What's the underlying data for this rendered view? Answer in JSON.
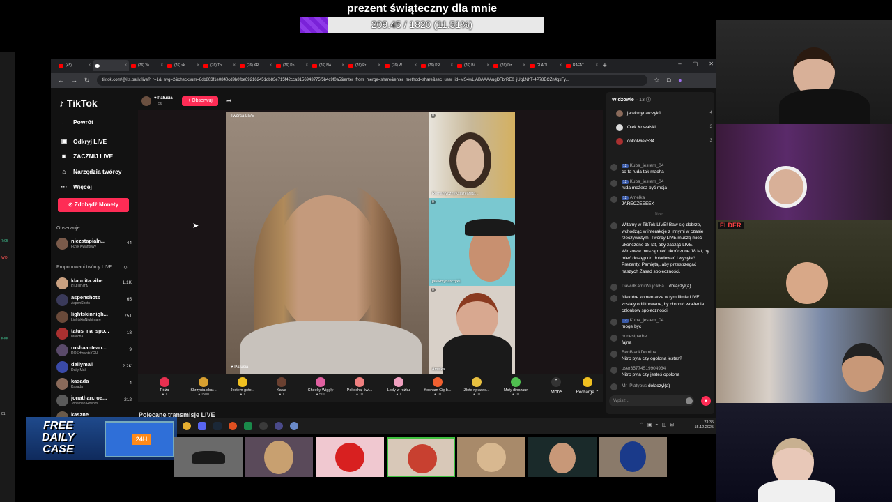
{
  "goal": {
    "title": "prezent świąteczny dla mnie",
    "progress_text": "209.45 / 1820 (11.51%)",
    "progress_fraction": 0.1151
  },
  "browser": {
    "tabs": [
      {
        "label": "(45)",
        "active": false
      },
      {
        "label": "",
        "active": true
      },
      {
        "label": "(76) Yo",
        "active": false
      },
      {
        "label": "(76) sk",
        "active": false
      },
      {
        "label": "(76) Th",
        "active": false
      },
      {
        "label": "(76) KR",
        "active": false
      },
      {
        "label": "(76) Po",
        "active": false
      },
      {
        "label": "(76) NA",
        "active": false
      },
      {
        "label": "(76) Pr",
        "active": false
      },
      {
        "label": "(76) W",
        "active": false
      },
      {
        "label": "(76) PR",
        "active": false
      },
      {
        "label": "(76) Bi",
        "active": false
      },
      {
        "label": "(76) Dz",
        "active": false
      },
      {
        "label": "GLADI",
        "active": false
      },
      {
        "label": "RAFAT",
        "active": false
      }
    ],
    "url": "tiktok.com/@its.pativ/live?_r=1&_svg=2&checksum=8cb803f1e0840cd9b0fbe692162451db83e715f42cca3156943775f5b4c9f0a5&enter_from_merge=share&enter_method=share&sec_user_id=MS4wLjABAAAAugDFbrRE0_jUg1NhT-4P78ECZn4gxFy..."
  },
  "sidebar": {
    "logo": "TikTok",
    "nav": [
      {
        "label": "Powrót",
        "icon": "arrow-left-icon"
      },
      {
        "label": "Odkryj LIVE",
        "icon": "live-icon"
      },
      {
        "label": "ZACZNIJ LIVE",
        "icon": "camera-icon"
      },
      {
        "label": "Narzędzia twórcy",
        "icon": "home-icon"
      },
      {
        "label": "Więcej",
        "icon": "more-icon"
      }
    ],
    "coins_button": "Zdobądź Monety",
    "following_header": "Obserwuje",
    "following": [
      {
        "name": "niezatapialn...",
        "sub": "Fizyk Kwantowy",
        "count": "44",
        "color": "#7a5a4a"
      }
    ],
    "suggested_header": "Proponowani twórcy LIVE",
    "suggested": [
      {
        "name": "klaudita.vibe",
        "sub": "KLAUDITA",
        "count": "1.1K",
        "color": "#c9a080"
      },
      {
        "name": "aspenshots",
        "sub": "AspenShots",
        "count": "65",
        "color": "#3a3a5a"
      },
      {
        "name": "lightskinnigh...",
        "sub": "LightskinNightmare",
        "count": "751",
        "color": "#6a4a3a"
      },
      {
        "name": "tatus_na_spo...",
        "sub": "Malicha",
        "count": "18",
        "color": "#aa3030"
      },
      {
        "name": "roshaantean...",
        "sub": "ROSHwantsYOU",
        "count": "9",
        "color": "#5a4a6a"
      },
      {
        "name": "dailymail",
        "sub": "Daily Mail",
        "count": "2.2K",
        "color": "#3a4aa8"
      },
      {
        "name": "kasada_",
        "sub": "Kasada",
        "count": "4",
        "color": "#8a6a5a"
      },
      {
        "name": "jonathan.roe...",
        "sub": "Jonathan Roehm",
        "count": "212",
        "color": "#5a5a5a"
      },
      {
        "name": "kaszne",
        "sub": "",
        "count": "",
        "color": "#6a5a4a"
      }
    ]
  },
  "stream": {
    "host_name": "Patusia",
    "host_sub": "56",
    "follow_button": "+ Obserwuj",
    "main_label": "Twórca LIVE",
    "main_name": "Patusia",
    "guests": [
      {
        "label": "RomantycznyKsiążęMeta...",
        "badge": "0"
      },
      {
        "label": "jarekmynarczyk1",
        "badge": "0"
      },
      {
        "label": "Amelka",
        "badge": "0"
      }
    ],
    "gifts": [
      {
        "name": "Róża",
        "price": "1",
        "color": "#e83050"
      },
      {
        "name": "Skrzynia skar...",
        "price": "1500",
        "color": "#d8a030"
      },
      {
        "name": "Jestem goto...",
        "price": "1",
        "color": "#f0c020"
      },
      {
        "name": "Kawa",
        "price": "1",
        "color": "#6a4030"
      },
      {
        "name": "Cheeky Wiggly",
        "price": "500",
        "color": "#e060a0"
      },
      {
        "name": "Pokochaj świ...",
        "price": "10",
        "color": "#f08080"
      },
      {
        "name": "Lody w rożku",
        "price": "1",
        "color": "#f0a0c0"
      },
      {
        "name": "Kocham Cię b...",
        "price": "10",
        "color": "#f06030"
      },
      {
        "name": "Złote rękawic...",
        "price": "10",
        "color": "#e8c040"
      },
      {
        "name": "Mały dinozaur",
        "price": "10",
        "color": "#50c050"
      }
    ],
    "more_label": "More",
    "recharge_label": "Recharge",
    "recommended_header": "Polecane transmisje LIVE"
  },
  "chat": {
    "viewers_label": "Widzowie",
    "viewers_count": "· 13",
    "viewers": [
      {
        "name": "jarekmynarczyk1",
        "count": "4",
        "color": "#8a6a5a"
      },
      {
        "name": "Olek Kowalski",
        "count": "3",
        "color": "#dddddd"
      },
      {
        "name": "cokolwiek534",
        "count": "3",
        "color": "#aa3030"
      }
    ],
    "messages": [
      {
        "user": "Kuba_jestem_04",
        "level": "12",
        "text": "co ta ruda tak macha"
      },
      {
        "user": "Kuba_jestem_04",
        "level": "12",
        "text": "ruda możesz być moja"
      },
      {
        "user": "Amelka",
        "level": "12",
        "text": "JARECZEEEEK"
      }
    ],
    "separator": "Nowy",
    "system_welcome": "Witamy w TikTok LIVE! Baw się dobrze, wchodząc w interakcje z innymi w czasie rzeczywistym. Twórcy LIVE muszą mieć ukończone 18 lat, aby zacząć LIVE. Widzowie muszą mieć ukończone 18 lat, by mieć dostęp do doładowań i wysyłać Prezenty. Pamiętaj, aby przestrzegać naszych Zasad społeczności.",
    "joined1_user": "DawidKamilWujcikFa...",
    "joined1_text": "dołączył(a)",
    "system_filter": "Niektóre komentarze w tym filmie LIVE zostały odfiltrowane, by chronić wrażenia członków społeczności.",
    "messages2": [
      {
        "user": "Kuba_jestem_04",
        "level": "12",
        "text": "moge byc"
      },
      {
        "user": "honestpadre",
        "level": "",
        "text": "fajna"
      },
      {
        "user": "BenBlackDomina",
        "level": "",
        "text": "Nitro pyta czy ogolona jestes?"
      },
      {
        "user": "user35774519904934",
        "level": "",
        "text": "Nitro pyta czy jesteś ogolona"
      }
    ],
    "joined2_user": "Mr_Platypus",
    "joined2_text": "dołączył(a)",
    "input_placeholder": "Wpisz..."
  },
  "taskbar": {
    "time": "23:35",
    "date": "15.12.2025"
  },
  "promo": {
    "text_line1": "FREE",
    "text_line2": "DAILY",
    "text_line3": "CASE",
    "badge": "24H"
  },
  "overlay_logo": "ELDER"
}
